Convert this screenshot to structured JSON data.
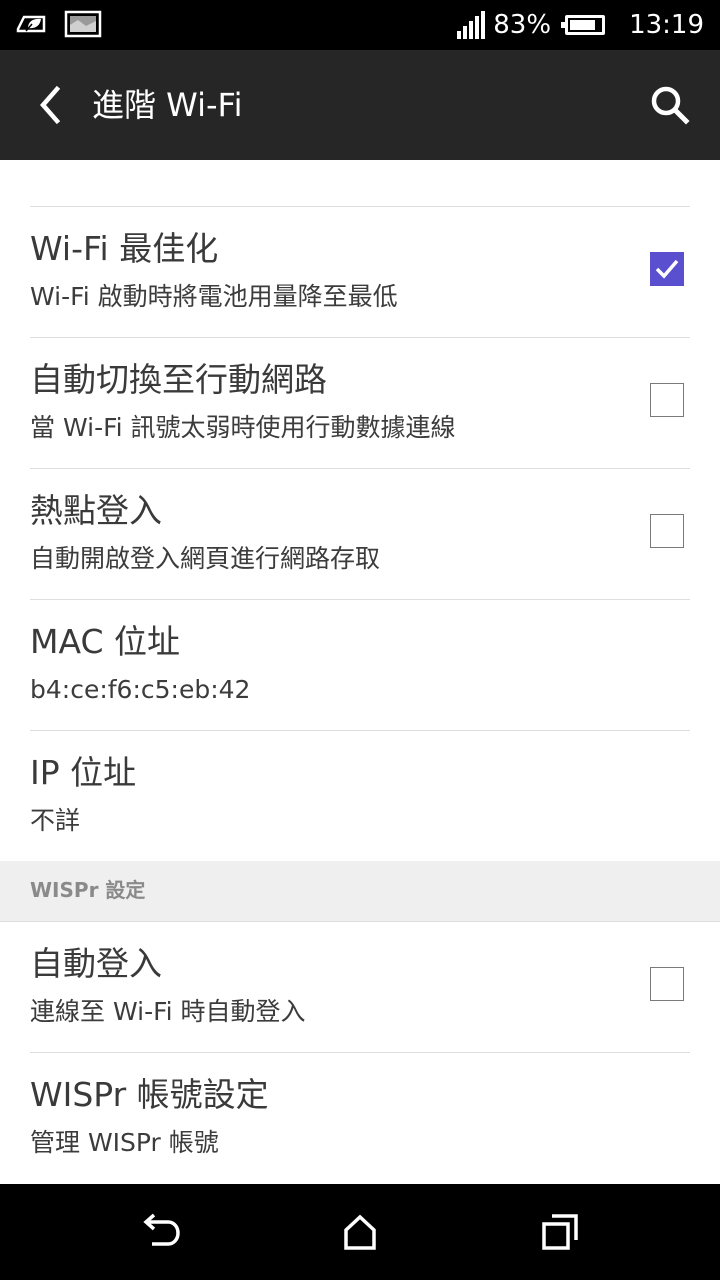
{
  "status_bar": {
    "left_icons": [
      "leaf-notification-icon",
      "image-notification-icon"
    ],
    "signal_icon": "signal-bars-icon",
    "battery_percent": "83%",
    "battery_level": 0.83,
    "time": "13:19"
  },
  "app_bar": {
    "title": "進階 Wi-Fi",
    "back_icon": "chevron-left-icon",
    "search_icon": "search-icon"
  },
  "settings": {
    "wifi_optimization": {
      "title": "Wi-Fi 最佳化",
      "subtitle": "Wi-Fi 啟動時將電池用量降至最低",
      "checked": true
    },
    "auto_switch_mobile": {
      "title": "自動切換至行動網路",
      "subtitle": "當 Wi-Fi 訊號太弱時使用行動數據連線",
      "checked": false
    },
    "hotspot_login": {
      "title": "熱點登入",
      "subtitle": "自動開啟登入網頁進行網路存取",
      "checked": false
    },
    "mac_address": {
      "title": "MAC 位址",
      "value": "b4:ce:f6:c5:eb:42"
    },
    "ip_address": {
      "title": "IP 位址",
      "value": "不詳"
    },
    "wispr_section": {
      "header": "WISPr 設定"
    },
    "auto_login": {
      "title": "自動登入",
      "subtitle": "連線至 Wi-Fi 時自動登入",
      "checked": false
    },
    "wispr_account": {
      "title": "WISPr 帳號設定",
      "subtitle": "管理 WISPr 帳號"
    }
  },
  "colors": {
    "accent": "#5a4fcf",
    "app_bar": "#262626",
    "section_bg": "#efefef"
  },
  "nav_bar": {
    "back_icon": "nav-back-icon",
    "home_icon": "nav-home-icon",
    "recents_icon": "nav-recents-icon"
  }
}
